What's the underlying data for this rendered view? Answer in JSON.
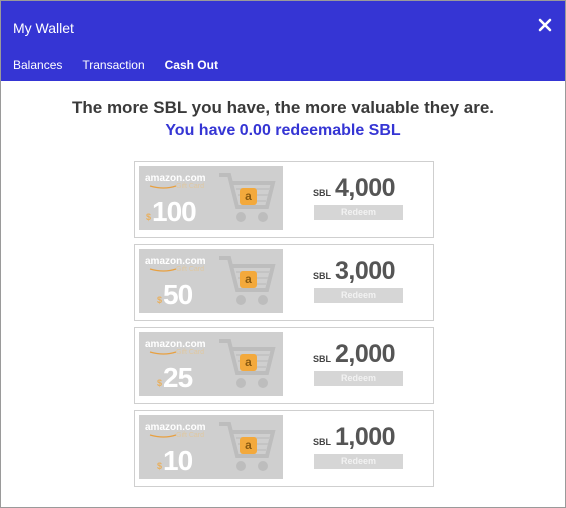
{
  "header": {
    "title": "My Wallet",
    "tabs": [
      {
        "label": "Balances",
        "active": false
      },
      {
        "label": "Transaction",
        "active": false
      },
      {
        "label": "Cash Out",
        "active": true
      }
    ],
    "close_icon": "close-icon",
    "background": "#3535d4"
  },
  "cashout": {
    "headline": "The more SBL you have, the more valuable they are.",
    "redeemable_text": "You have 0.00 redeemable SBL",
    "accent": "#3535d4",
    "cards": [
      {
        "brand": "amazon.com",
        "card_label": "Gift Card",
        "currency": "$",
        "value": "100",
        "unit": "SBL",
        "cost": "4,000",
        "button": "Redeem"
      },
      {
        "brand": "amazon.com",
        "card_label": "Gift Card",
        "currency": "$",
        "value": "50",
        "unit": "SBL",
        "cost": "3,000",
        "button": "Redeem"
      },
      {
        "brand": "amazon.com",
        "card_label": "Gift Card",
        "currency": "$",
        "value": "25",
        "unit": "SBL",
        "cost": "2,000",
        "button": "Redeem"
      },
      {
        "brand": "amazon.com",
        "card_label": "Gift Card",
        "currency": "$",
        "value": "10",
        "unit": "SBL",
        "cost": "1,000",
        "button": "Redeem"
      }
    ]
  }
}
